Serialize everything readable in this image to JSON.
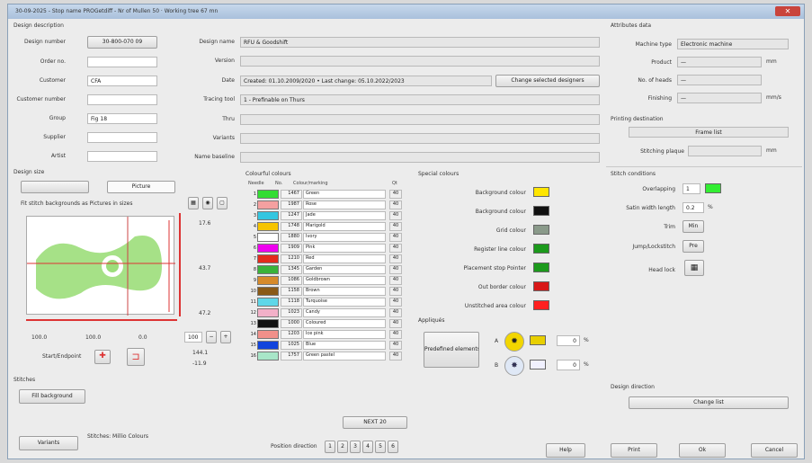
{
  "window": {
    "title": "30-09-2025 - Stop name PROGetdiff - Nr of Mullen 50 · Working tree 67 mn",
    "close": "✕"
  },
  "design_description": {
    "section": "Design description",
    "design_number_label": "Design number",
    "design_number": "30-800-070 09",
    "order_no_label": "Order no.",
    "order_no": "",
    "customer_label": "Customer",
    "customer": "CFA",
    "customer_number_label": "Customer number",
    "customer_number": "",
    "group_label": "Group",
    "group": "Fig 18",
    "supplier_label": "Supplier",
    "supplier": "",
    "artist_label": "Artist",
    "artist": "",
    "design_name_label": "Design name",
    "design_name": "RFU & Goodshift",
    "version_label": "Version",
    "version": "",
    "date_label": "Date",
    "date": "Created: 01.10.2009/2020 • Last change: 05.10.2022/2023",
    "change_btn": "Change selected designers",
    "tracing_label": "Tracing tool",
    "tracing": "1 - Prefinable on Thurs",
    "thru_label": "Thru",
    "thru": "",
    "variants_label": "Variants",
    "variants": "",
    "name_label": "Name baseline",
    "name": ""
  },
  "attributes": {
    "section": "Attributes data",
    "machine_label": "Machine type",
    "machine": "Electronic machine",
    "product_label": "Product",
    "product": "—",
    "product_unit": "mm",
    "heads_label": "No. of heads",
    "heads": "—",
    "finishing_label": "Finishing",
    "finishing": "—",
    "finishing_unit": "mm/s"
  },
  "printing": {
    "section": "Printing destination",
    "frame_label": "Frame list",
    "width_label": "Stitching plaque",
    "width_unit": "mm"
  },
  "stitch_settings": {
    "section": "Stitch conditions",
    "overlap_label": "Overlapping",
    "overlap": "1",
    "width_label": "Satin width length",
    "width": "0.2",
    "width_unit": "%",
    "trim_label": "Trim",
    "trim": "Min",
    "jump_label": "Jump/Lockstitch",
    "jump": "Pre",
    "head_label": "Head lock"
  },
  "design_size": {
    "section": "Design size",
    "tab_left": "",
    "tab_right": "Picture",
    "subtitle": "Fit stitch backgrounds as Pictures in sizes",
    "right_vals": [
      "17.6",
      "43.7",
      "47.2"
    ],
    "bottom_vals": [
      "100.0",
      "100.0",
      "0.0"
    ],
    "zoom": "100",
    "start_label": "Start/Endpoint",
    "offset_x": "144.1",
    "offset_y": "-11.9"
  },
  "stitches": {
    "section": "Stitches",
    "btn": "Fill background",
    "colors_label": "Stitches: Millio Colours",
    "variants_btn": "Variants"
  },
  "colour_table": {
    "section": "Colourful colours",
    "headers": [
      "Needle",
      "No.",
      "Colour/marking",
      "Qt"
    ],
    "rows": [
      {
        "n": "1",
        "color": "#33dd33",
        "code": "1467",
        "name": "Green",
        "cnt": "40"
      },
      {
        "n": "2",
        "color": "#f4a0a0",
        "code": "1987",
        "name": "Rose",
        "cnt": "40"
      },
      {
        "n": "3",
        "color": "#33c6e0",
        "code": "1247",
        "name": "Jade",
        "cnt": "40"
      },
      {
        "n": "4",
        "color": "#f6c400",
        "code": "1748",
        "name": "Marigold",
        "cnt": "40"
      },
      {
        "n": "5",
        "color": "#ffffff",
        "code": "1880",
        "name": "Ivory",
        "cnt": "40"
      },
      {
        "n": "6",
        "color": "#ee00ee",
        "code": "1909",
        "name": "Pink",
        "cnt": "40"
      },
      {
        "n": "7",
        "color": "#e42b1c",
        "code": "1210",
        "name": "Red",
        "cnt": "40"
      },
      {
        "n": "8",
        "color": "#3ab33a",
        "code": "1345",
        "name": "Garden",
        "cnt": "40"
      },
      {
        "n": "9",
        "color": "#d68a2a",
        "code": "1086",
        "name": "Goldbrown",
        "cnt": "40"
      },
      {
        "n": "10",
        "color": "#8a5a17",
        "code": "1158",
        "name": "Brown",
        "cnt": "40"
      },
      {
        "n": "11",
        "color": "#5fd7e8",
        "code": "1118",
        "name": "Turquoise",
        "cnt": "40"
      },
      {
        "n": "12",
        "color": "#f2b0c8",
        "code": "1023",
        "name": "Candy",
        "cnt": "40"
      },
      {
        "n": "13",
        "color": "#111111",
        "code": "1000",
        "name": "Coloured",
        "cnt": "40"
      },
      {
        "n": "14",
        "color": "#f0908a",
        "code": "1203",
        "name": "Ice pink",
        "cnt": "40"
      },
      {
        "n": "15",
        "color": "#1144dd",
        "code": "1025",
        "name": "Blue",
        "cnt": "40"
      },
      {
        "n": "16",
        "color": "#a8e6c8",
        "code": "1757",
        "name": "Green pastel",
        "cnt": "40"
      }
    ],
    "sort_btn": "NEXT 20",
    "positions_label": "Position direction",
    "positions": [
      "1",
      "2",
      "3",
      "4",
      "5",
      "6"
    ]
  },
  "special_colours": {
    "section": "Special colours",
    "items": [
      {
        "label": "Background colour",
        "color": "#ffe600"
      },
      {
        "label": "Background colour",
        "color": "#111111"
      },
      {
        "label": "Grid colour",
        "color": "#8a9a8a"
      },
      {
        "label": "Register line colour",
        "color": "#1c9a1c"
      },
      {
        "label": "Placement stop Pointer",
        "color": "#1c9a1c"
      },
      {
        "label": "Out border colour",
        "color": "#d81818"
      },
      {
        "label": "Unstitched area colour",
        "color": "#ff2020"
      }
    ]
  },
  "appliqués": {
    "section": "Appliqués",
    "btn": "Predefined elements",
    "a_label": "A",
    "a_val": "0",
    "b_label": "B",
    "b_val": "0",
    "unit": "%"
  },
  "design_direction": {
    "section": "Design direction",
    "btn": "Change list"
  },
  "footer": {
    "help": "Help",
    "print": "Print",
    "ok": "Ok",
    "cancel": "Cancel"
  }
}
